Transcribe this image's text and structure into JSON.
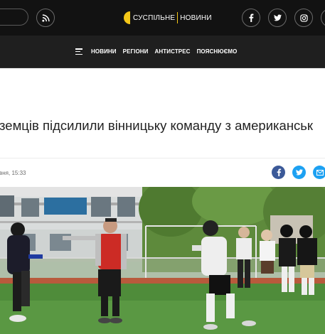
{
  "header": {
    "logo_left": "СУСПІЛЬНЕ",
    "logo_right": "НОВИНИ",
    "icons": [
      "rss-icon",
      "facebook-icon",
      "twitter-icon",
      "instagram-icon"
    ]
  },
  "nav": {
    "items": [
      "НОВИНИ",
      "РЕГІОНИ",
      "АНТИСТРЕС",
      "ПОЯСНЮЄМО"
    ]
  },
  "article": {
    "headline": "земців підсилили вінницьку команду з американськ",
    "date": "вня, 15:33",
    "share": [
      "facebook-share-icon",
      "twitter-share-icon",
      "email-share-icon"
    ]
  },
  "colors": {
    "topbar": "#121212",
    "navbar": "#1f1f1f",
    "accent": "#f4c718",
    "facebook": "#3b5998",
    "twitter": "#1da1f2"
  }
}
